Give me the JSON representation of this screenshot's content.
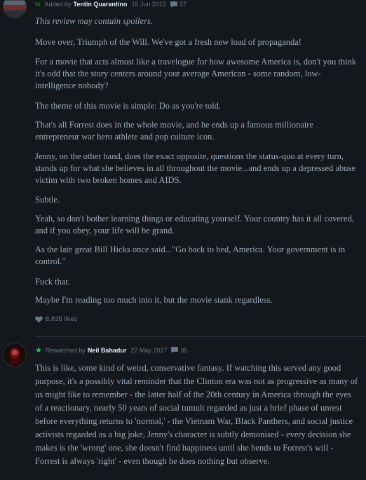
{
  "review1": {
    "rating": "½",
    "activity_label": "Added by",
    "author": "Tentin Quarantino",
    "date": "15 Jun 2012",
    "comment_count": "57",
    "spoiler_notice": "This review may contain spoilers.",
    "paragraphs": [
      "Move over, Triumph of the Will. We've got a fresh new load of propaganda!",
      "For a movie that acts almost like a travelogue for how awesome America is, don't you think it's odd that the story centers around your average American - some random, low-intelligence nobody?",
      "The theme of this movie is simple: Do as you're told.",
      "That's all Forrest does in the whole movie, and he ends up a famous millionaire entrepreneur war hero athlete and pop culture icon.",
      "Jenny, on the other hand, does the exact opposite, questions the status-quo at every turn, stands up for what she believes in all throughout the movie...and ends up a depressed abuse victim with two broken homes and AIDS.",
      "Subtle.",
      "Yeah, so don't bother learning things or educating yourself. Your country has it all covered, and if you obey, your life will be grand.",
      "As the late great Bill Hicks once said...\"Go back to bed, America. Your government is in control.\"",
      "Fuck that.",
      "Maybe I'm reading too much into it, but the movie stank regardless."
    ],
    "likes": "8,835 likes"
  },
  "review2": {
    "rating": "★",
    "activity_label": "Rewatched by",
    "author": "Neil Bahadur",
    "date": "27 May 2017",
    "comment_count": "35",
    "paragraph": "This is like, some kind of weird, conservative fantasy. If watching this served any good purpose, it's a possibly vital reminder that the Clinton era was not as progressive as many of us might like to remember - the latter half of the 20th century in America through the eyes of a reactionary, nearly 50 years of social tumult regarded as just a brief phase of unrest before everything returns to 'normal,' - the Vietnam War, Black Panthers, and social justice activists regarded as a big joke, Jenny's character is subtly demonised - every decision she makes is the 'wrong' one, she doesn't find happiness until she bends to Forrest's will - Forrest is always 'right' - even though he does nothing but observe."
  },
  "colors": {
    "background": "#14181c",
    "text": "#99aabb",
    "accent_green": "#00e054"
  }
}
